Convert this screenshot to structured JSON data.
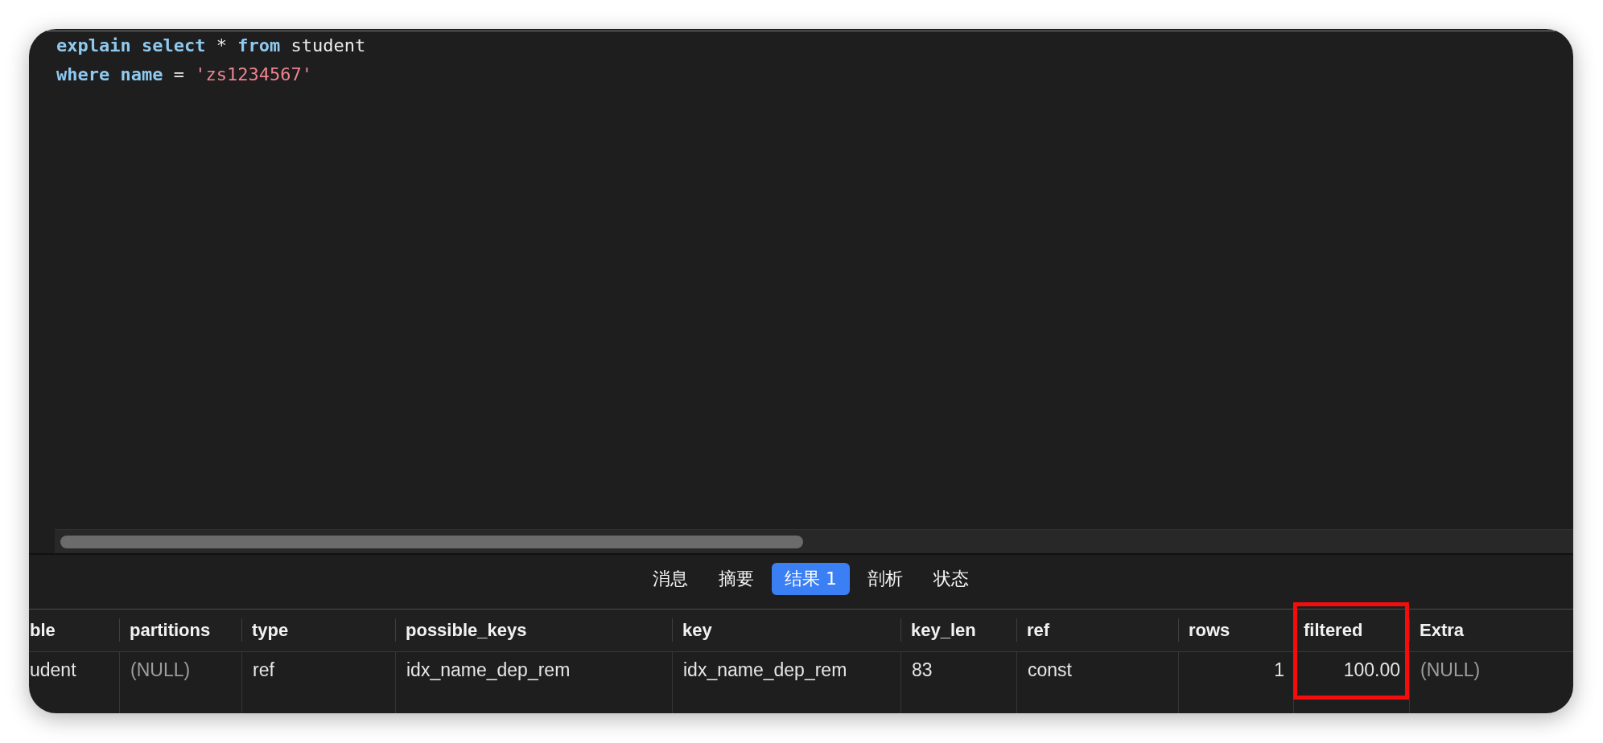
{
  "editor": {
    "lines": [
      {
        "tokens": [
          {
            "kind": "keyword",
            "text": "explain select"
          },
          {
            "kind": "plain",
            "text": " * "
          },
          {
            "kind": "keyword",
            "text": "from"
          },
          {
            "kind": "plain",
            "text": " student"
          }
        ]
      },
      {
        "tokens": [
          {
            "kind": "keyword",
            "text": "where name"
          },
          {
            "kind": "plain",
            "text": " = "
          },
          {
            "kind": "string",
            "text": "'zs1234567'"
          }
        ]
      }
    ]
  },
  "result_tabs": [
    {
      "label": "消息",
      "selected": false
    },
    {
      "label": "摘要",
      "selected": false
    },
    {
      "label": "结果 1",
      "selected": true
    },
    {
      "label": "剖析",
      "selected": false
    },
    {
      "label": "状态",
      "selected": false
    }
  ],
  "table": {
    "columns": [
      {
        "label": "ble",
        "numeric": false,
        "highlighted": false
      },
      {
        "label": "partitions",
        "numeric": false,
        "highlighted": false
      },
      {
        "label": "type",
        "numeric": false,
        "highlighted": false
      },
      {
        "label": "possible_keys",
        "numeric": false,
        "highlighted": false
      },
      {
        "label": "key",
        "numeric": false,
        "highlighted": false
      },
      {
        "label": "key_len",
        "numeric": false,
        "highlighted": false
      },
      {
        "label": "ref",
        "numeric": false,
        "highlighted": false
      },
      {
        "label": "rows",
        "numeric": true,
        "highlighted": false
      },
      {
        "label": "filtered",
        "numeric": true,
        "highlighted": true
      },
      {
        "label": "Extra",
        "numeric": false,
        "highlighted": false
      }
    ],
    "rows": [
      {
        "cells": [
          {
            "text": "udent",
            "is_null": false
          },
          {
            "text": "(NULL)",
            "is_null": true
          },
          {
            "text": "ref",
            "is_null": false
          },
          {
            "text": "idx_name_dep_rem",
            "is_null": false
          },
          {
            "text": "idx_name_dep_rem",
            "is_null": false
          },
          {
            "text": "83",
            "is_null": false
          },
          {
            "text": "const",
            "is_null": false
          },
          {
            "text": "1",
            "is_null": false
          },
          {
            "text": "100.00",
            "is_null": false
          },
          {
            "text": "(NULL)",
            "is_null": true
          }
        ]
      }
    ]
  }
}
